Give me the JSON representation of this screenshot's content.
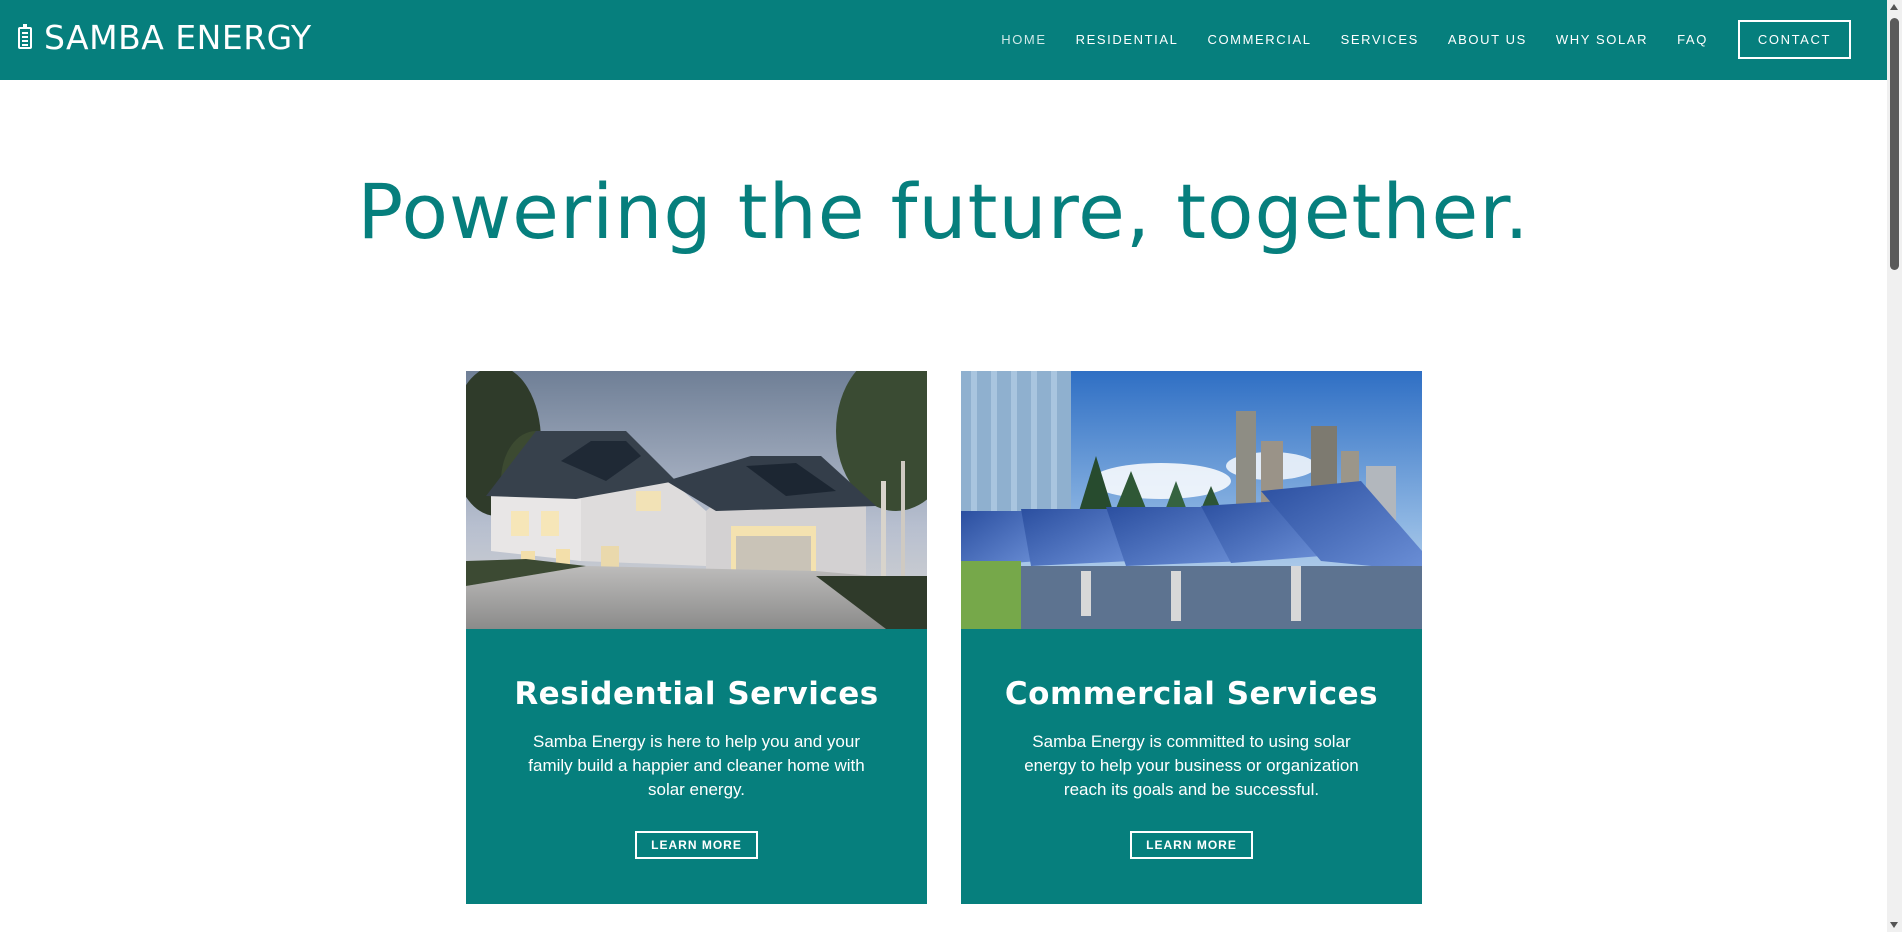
{
  "header": {
    "brand": "SAMBA ENERGY",
    "nav": [
      {
        "label": "HOME",
        "name": "nav-home"
      },
      {
        "label": "RESIDENTIAL",
        "name": "nav-residential"
      },
      {
        "label": "COMMERCIAL",
        "name": "nav-commercial"
      },
      {
        "label": "SERVICES",
        "name": "nav-services"
      },
      {
        "label": "ABOUT US",
        "name": "nav-about-us"
      },
      {
        "label": "WHY SOLAR",
        "name": "nav-why-solar"
      },
      {
        "label": "FAQ",
        "name": "nav-faq"
      }
    ],
    "contact_label": "CONTACT"
  },
  "hero": {
    "title": "Powering the future, together."
  },
  "cards": [
    {
      "title": "Residential Services",
      "text": "Samba Energy is here to help you and your family build a happier and cleaner home with solar energy.",
      "button": "LEARN MORE"
    },
    {
      "title": "Commercial Services",
      "text": "Samba Energy is committed to using solar energy to help your business or organization reach its goals and be successful.",
      "button": "LEARN MORE"
    }
  ],
  "theme": {
    "primary": "#067f7d",
    "text_light": "#ffffff"
  }
}
